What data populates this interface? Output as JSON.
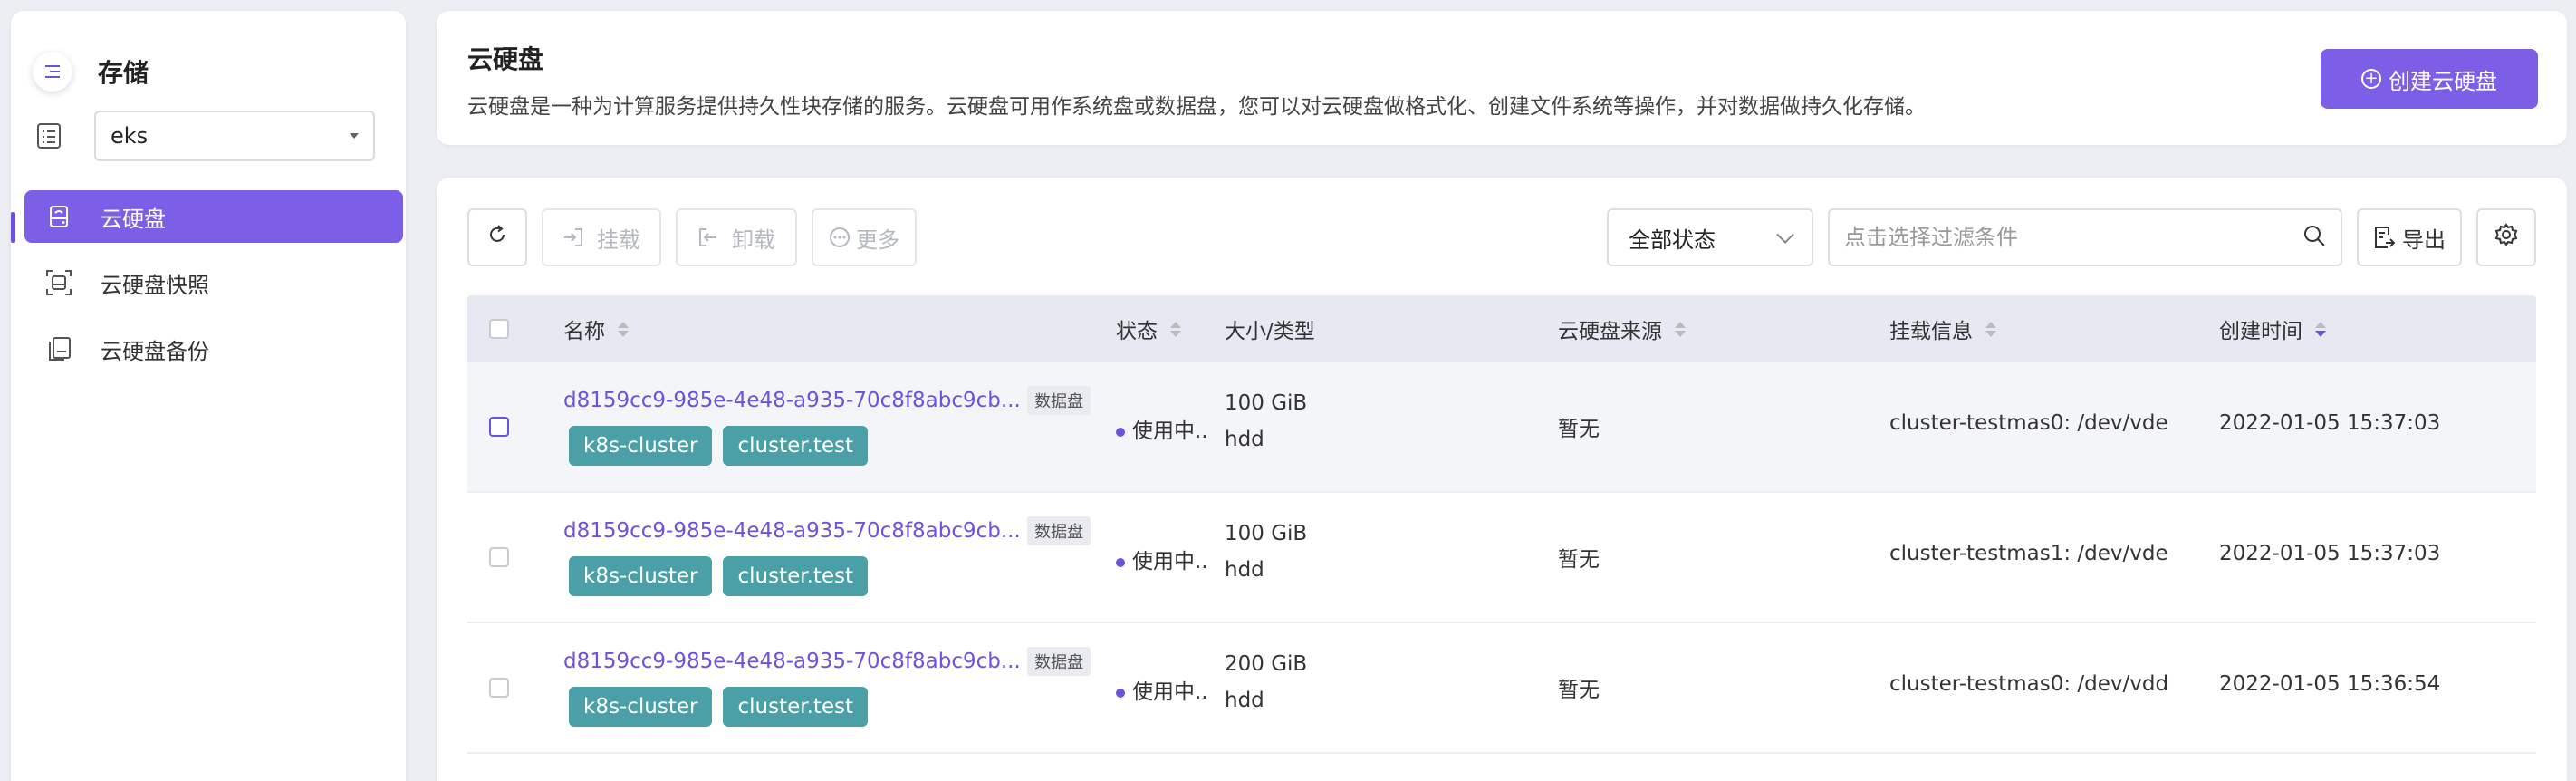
{
  "sidebar": {
    "title": "存储",
    "project": "eks",
    "items": [
      {
        "label": "云硬盘",
        "active": true
      },
      {
        "label": "云硬盘快照",
        "active": false
      },
      {
        "label": "云硬盘备份",
        "active": false
      }
    ]
  },
  "header": {
    "title": "云硬盘",
    "description": "云硬盘是一种为计算服务提供持久性块存储的服务。云硬盘可用作系统盘或数据盘，您可以对云硬盘做格式化、创建文件系统等操作，并对数据做持久化存储。",
    "create_label": "创建云硬盘"
  },
  "toolbar": {
    "attach_label": "挂载",
    "detach_label": "卸载",
    "more_label": "更多",
    "status_filter": "全部状态",
    "search_placeholder": "点击选择过滤条件",
    "export_label": "导出"
  },
  "table": {
    "columns": {
      "name": "名称",
      "status": "状态",
      "size": "大小/类型",
      "source": "云硬盘来源",
      "attach": "挂载信息",
      "created": "创建时间"
    },
    "rows": [
      {
        "name": "d8159cc9-985e-4e48-a935-70c8f8abc9cb...",
        "type": "数据盘",
        "tags": [
          "k8s-cluster",
          "cluster.test"
        ],
        "status": "使用中..",
        "size": "100 GiB",
        "disk_type": "hdd",
        "source": "暂无",
        "attach": "cluster-testmas0: /dev/vde",
        "created": "2022-01-05 15:37:03"
      },
      {
        "name": "d8159cc9-985e-4e48-a935-70c8f8abc9cb...",
        "type": "数据盘",
        "tags": [
          "k8s-cluster",
          "cluster.test"
        ],
        "status": "使用中..",
        "size": "100 GiB",
        "disk_type": "hdd",
        "source": "暂无",
        "attach": "cluster-testmas1: /dev/vde",
        "created": "2022-01-05 15:37:03"
      },
      {
        "name": "d8159cc9-985e-4e48-a935-70c8f8abc9cb...",
        "type": "数据盘",
        "tags": [
          "k8s-cluster",
          "cluster.test"
        ],
        "status": "使用中..",
        "size": "200 GiB",
        "disk_type": "hdd",
        "source": "暂无",
        "attach": "cluster-testmas0: /dev/vdd",
        "created": "2022-01-05 15:36:54"
      }
    ]
  },
  "colors": {
    "accent": "#7c5fe6",
    "tag": "#4b9fa6"
  }
}
